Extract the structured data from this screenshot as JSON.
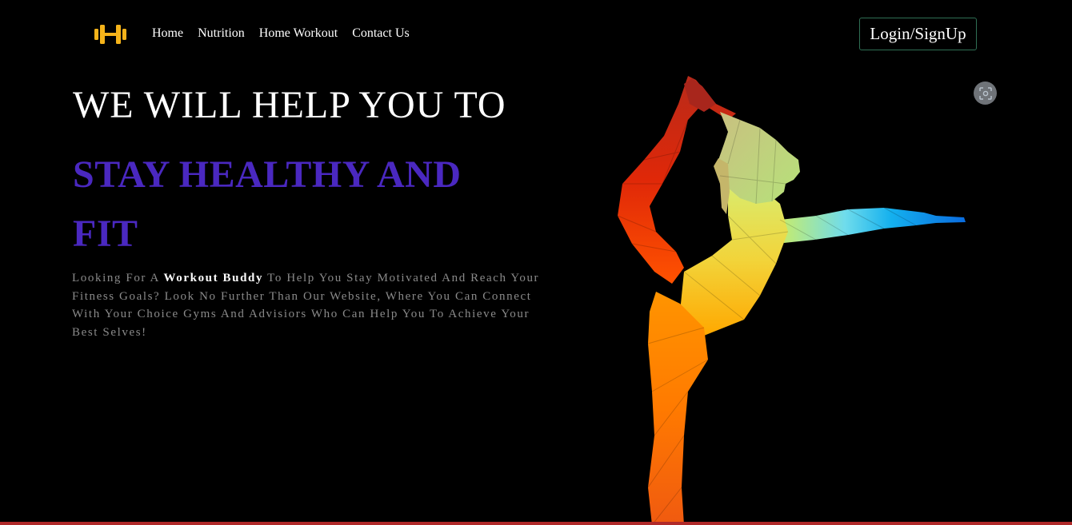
{
  "nav": {
    "logo_icon": "dumbbell-icon",
    "logo_color": "#f5b31a",
    "items": [
      {
        "label": "Home"
      },
      {
        "label": "Nutrition"
      },
      {
        "label": "Home Workout"
      },
      {
        "label": "Contact Us"
      }
    ],
    "login_label": "Login/SignUp"
  },
  "hero": {
    "headline": "WE WILL HELP YOU TO",
    "highlight": "STAY HEALTHY AND FIT",
    "highlight_color": "#4a28c0",
    "description_before": "Looking For A ",
    "description_bold": "Workout Buddy",
    "description_after": " To Help You Stay Motivated And Reach Your Fitness Goals? Look No Further Than Our Website, Where You Can Connect With Your Choice Gyms And Advisiors Who Can Help You To Achieve Your Best Selves!"
  },
  "figure": {
    "icon": "yoga-silhouette-illustration"
  },
  "overlay": {
    "icon": "screenshot-lens-icon"
  }
}
